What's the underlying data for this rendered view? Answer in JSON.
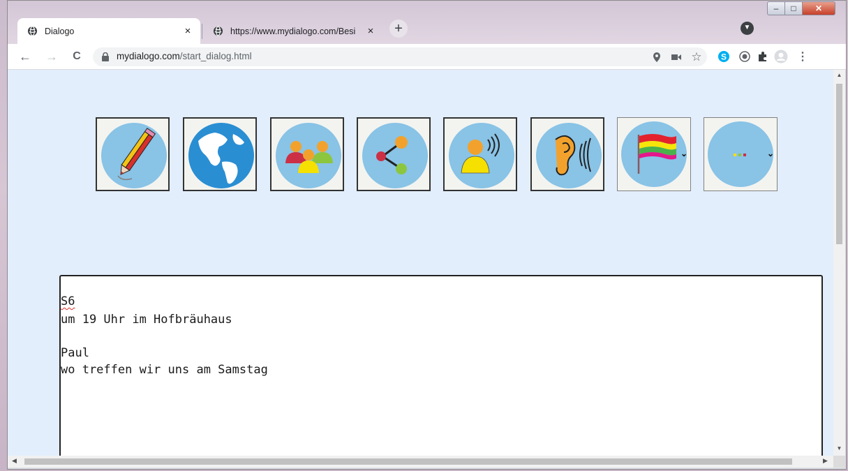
{
  "tabs": [
    {
      "title": "Dialogo",
      "active": true
    },
    {
      "title": "https://www.mydialogo.com/Besi",
      "active": false
    }
  ],
  "tab_close_glyph": "×",
  "new_tab_glyph": "+",
  "window_controls": {
    "minimize": "–",
    "maximize": "□",
    "close": "✕"
  },
  "toolbar": {
    "back_glyph": "←",
    "forward_glyph": "→",
    "reload_glyph": "C",
    "url_host": "mydialogo.com",
    "url_path": "/start_dialog.html",
    "extension_icons": [
      "location-icon",
      "camera-icon",
      "star-icon",
      "skype-icon",
      "extension-icon",
      "puzzle-icon",
      "profile-icon",
      "menu-icon"
    ]
  },
  "tool_buttons": [
    {
      "name": "pencil",
      "icon": "pencil-icon"
    },
    {
      "name": "globe",
      "icon": "globe-icon"
    },
    {
      "name": "group",
      "icon": "group-icon"
    },
    {
      "name": "share",
      "icon": "share-icon"
    },
    {
      "name": "speaker",
      "icon": "speaker-person-icon"
    },
    {
      "name": "listen",
      "icon": "ear-icon"
    },
    {
      "name": "language",
      "icon": "flag-icon",
      "dropdown": true
    },
    {
      "name": "more",
      "icon": "dots-icon",
      "dropdown": true
    }
  ],
  "colors": {
    "page_bg": "#e2eefb",
    "circle": "#89c3e6",
    "flag_red": "#e3222e",
    "flag_yellow": "#f5e50a",
    "flag_green": "#49b24b",
    "flag_pink": "#e4178a"
  },
  "dialog": {
    "lines": [
      "S6",
      "um 19 Uhr im Hofbräuhaus",
      "",
      "Paul",
      "wo treffen wir uns am Samstag"
    ]
  }
}
